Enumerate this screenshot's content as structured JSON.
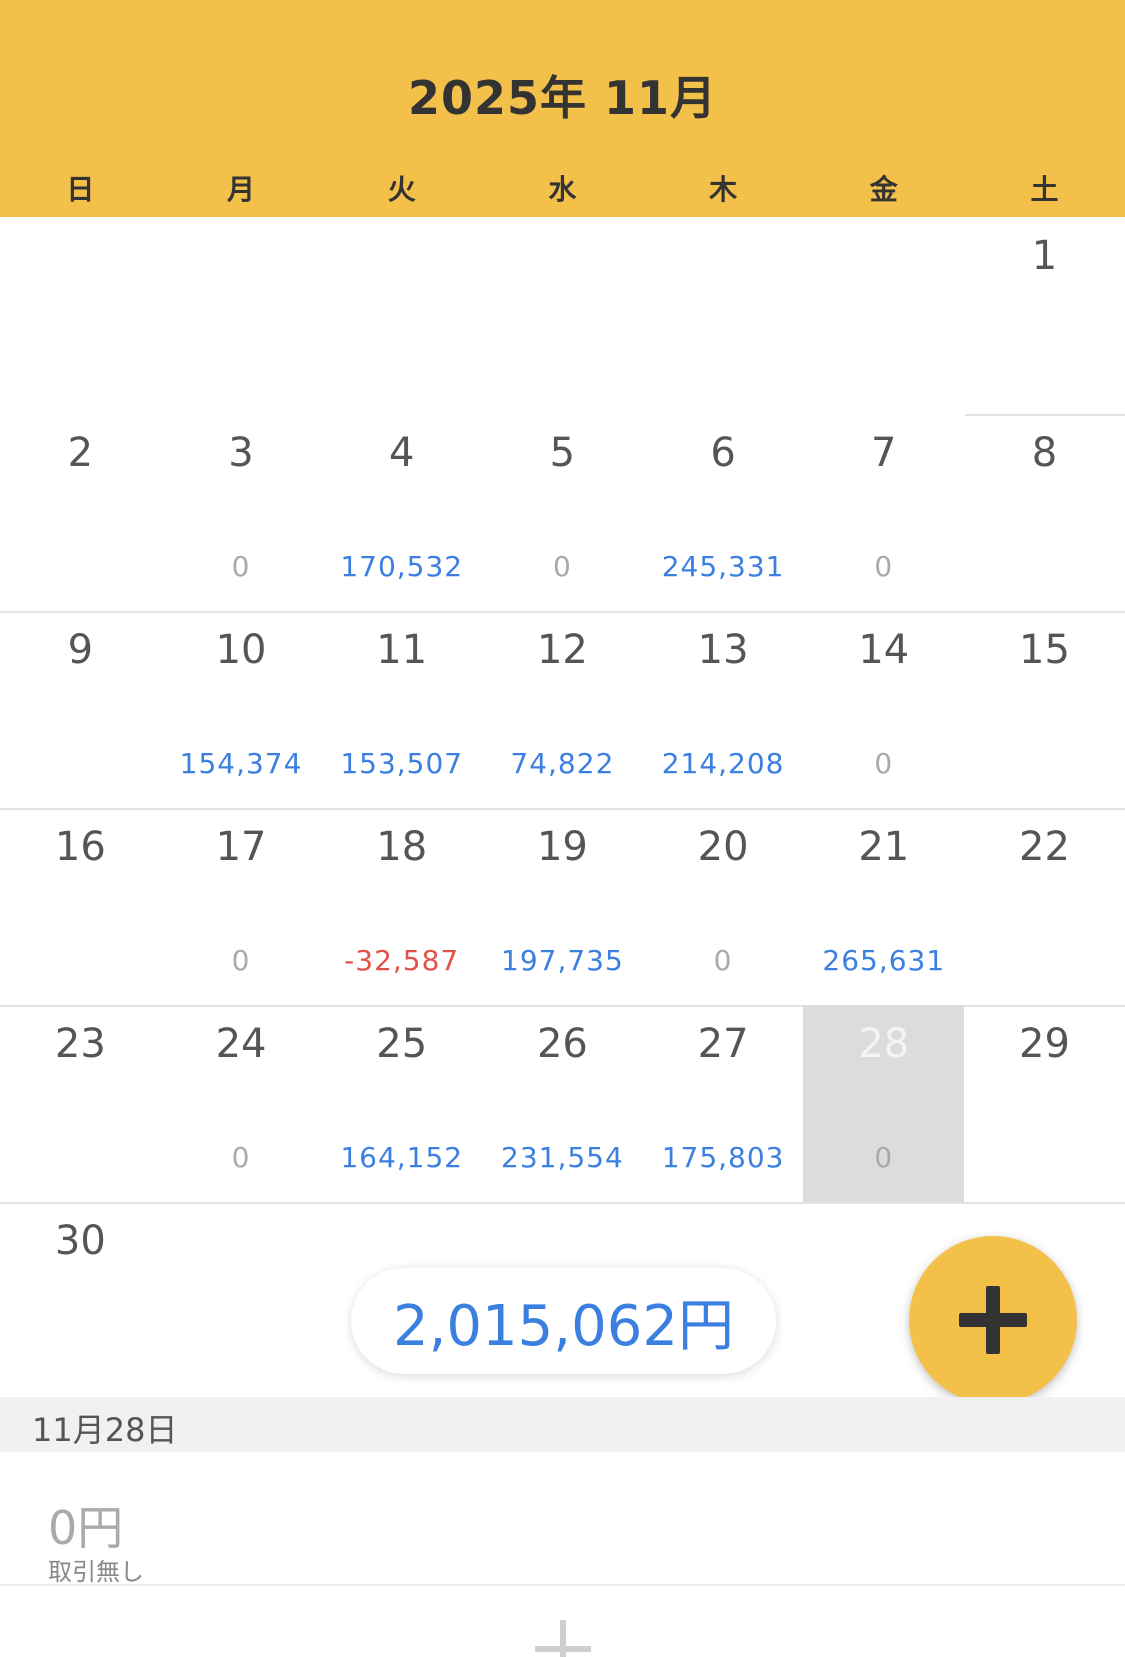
{
  "header": {
    "title": "2025年 11月",
    "weekdays": [
      "日",
      "月",
      "火",
      "水",
      "木",
      "金",
      "土"
    ]
  },
  "calendar": {
    "weeks": [
      [
        {
          "day": "",
          "amount": "",
          "type": ""
        },
        {
          "day": "",
          "amount": "",
          "type": ""
        },
        {
          "day": "",
          "amount": "",
          "type": ""
        },
        {
          "day": "",
          "amount": "",
          "type": ""
        },
        {
          "day": "",
          "amount": "",
          "type": ""
        },
        {
          "day": "",
          "amount": "",
          "type": ""
        },
        {
          "day": "1",
          "amount": "",
          "type": ""
        }
      ],
      [
        {
          "day": "2",
          "amount": "",
          "type": ""
        },
        {
          "day": "3",
          "amount": "0",
          "type": "zero"
        },
        {
          "day": "4",
          "amount": "170,532",
          "type": "pos"
        },
        {
          "day": "5",
          "amount": "0",
          "type": "zero"
        },
        {
          "day": "6",
          "amount": "245,331",
          "type": "pos"
        },
        {
          "day": "7",
          "amount": "0",
          "type": "zero"
        },
        {
          "day": "8",
          "amount": "",
          "type": ""
        }
      ],
      [
        {
          "day": "9",
          "amount": "",
          "type": ""
        },
        {
          "day": "10",
          "amount": "154,374",
          "type": "pos"
        },
        {
          "day": "11",
          "amount": "153,507",
          "type": "pos"
        },
        {
          "day": "12",
          "amount": "74,822",
          "type": "pos"
        },
        {
          "day": "13",
          "amount": "214,208",
          "type": "pos"
        },
        {
          "day": "14",
          "amount": "0",
          "type": "zero"
        },
        {
          "day": "15",
          "amount": "",
          "type": ""
        }
      ],
      [
        {
          "day": "16",
          "amount": "",
          "type": ""
        },
        {
          "day": "17",
          "amount": "0",
          "type": "zero"
        },
        {
          "day": "18",
          "amount": "-32,587",
          "type": "neg"
        },
        {
          "day": "19",
          "amount": "197,735",
          "type": "pos"
        },
        {
          "day": "20",
          "amount": "0",
          "type": "zero"
        },
        {
          "day": "21",
          "amount": "265,631",
          "type": "pos"
        },
        {
          "day": "22",
          "amount": "",
          "type": ""
        }
      ],
      [
        {
          "day": "23",
          "amount": "",
          "type": ""
        },
        {
          "day": "24",
          "amount": "0",
          "type": "zero"
        },
        {
          "day": "25",
          "amount": "164,152",
          "type": "pos"
        },
        {
          "day": "26",
          "amount": "231,554",
          "type": "pos"
        },
        {
          "day": "27",
          "amount": "175,803",
          "type": "pos"
        },
        {
          "day": "28",
          "amount": "0",
          "type": "zero",
          "selected": true
        },
        {
          "day": "29",
          "amount": "",
          "type": ""
        }
      ],
      [
        {
          "day": "30",
          "amount": "",
          "type": ""
        },
        {
          "day": "",
          "amount": "",
          "type": ""
        },
        {
          "day": "",
          "amount": "",
          "type": ""
        },
        {
          "day": "",
          "amount": "",
          "type": ""
        },
        {
          "day": "",
          "amount": "",
          "type": ""
        },
        {
          "day": "",
          "amount": "",
          "type": ""
        },
        {
          "day": "",
          "amount": "",
          "type": ""
        }
      ]
    ]
  },
  "total": {
    "label": "2,015,062円"
  },
  "fab": {
    "icon": "plus-icon"
  },
  "selected_date": {
    "label": "11月28日"
  },
  "detail": {
    "amount": "0円",
    "note": "取引無し"
  },
  "colors": {
    "accent": "#F3C04A",
    "positive": "#3B7FE0",
    "negative": "#E05248",
    "zero": "#aaaaaa"
  }
}
